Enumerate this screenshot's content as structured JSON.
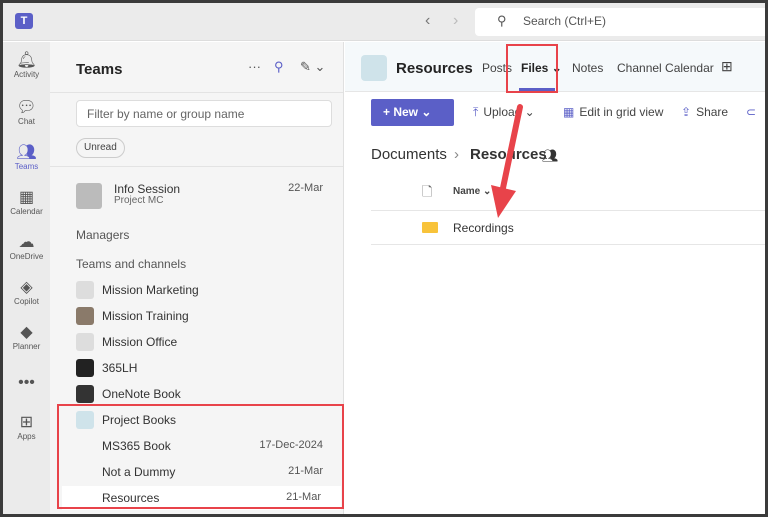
{
  "topbar": {
    "search_placeholder": "Search (Ctrl+E)",
    "back": "‹",
    "forward": "›"
  },
  "rail": [
    {
      "label": "Activity",
      "icon": "bell-icon",
      "glyph": "🔔︎"
    },
    {
      "label": "Chat",
      "icon": "chat-icon",
      "glyph": "💬︎"
    },
    {
      "label": "Teams",
      "icon": "teams-icon",
      "glyph": "👥︎",
      "active": true
    },
    {
      "label": "Calendar",
      "icon": "calendar-icon",
      "glyph": "▦"
    },
    {
      "label": "OneDrive",
      "icon": "cloud-icon",
      "glyph": "☁"
    },
    {
      "label": "Copilot",
      "icon": "copilot-icon",
      "glyph": "◈"
    },
    {
      "label": "Planner",
      "icon": "planner-icon",
      "glyph": "◆"
    },
    {
      "label": "",
      "icon": "more-icon",
      "glyph": "•••"
    },
    {
      "label": "Apps",
      "icon": "apps-icon",
      "glyph": "⊞"
    }
  ],
  "panel": {
    "title": "Teams",
    "filter_placeholder": "Filter by name or group name",
    "chip": "Unread",
    "pinned": {
      "name": "Info Session",
      "sub": "Project MC",
      "date": "22-Mar"
    },
    "section1": "Managers",
    "section2": "Teams and channels",
    "teams": [
      "Mission Marketing",
      "Mission Training",
      "Mission Office",
      "365LH",
      "OneNote Book",
      "Project Books"
    ],
    "channels": [
      {
        "name": "MS365 Book",
        "date": "17-Dec-2024"
      },
      {
        "name": "Not a Dummy",
        "date": "21-Mar"
      },
      {
        "name": "Resources",
        "date": "21-Mar",
        "selected": true
      }
    ]
  },
  "main": {
    "channel": "Resources",
    "tabs": [
      "Posts",
      "Files",
      "Notes",
      "Channel Calendar"
    ],
    "active_tab": "Files",
    "toolbar": {
      "new": "New",
      "upload": "Upload",
      "grid": "Edit in grid view",
      "share": "Share"
    },
    "breadcrumb": [
      "Documents",
      "Resources"
    ],
    "column": "Name",
    "rows": [
      "Recordings"
    ]
  },
  "colors": {
    "accent": "#5b5fc7",
    "annotation": "#e8434a"
  }
}
